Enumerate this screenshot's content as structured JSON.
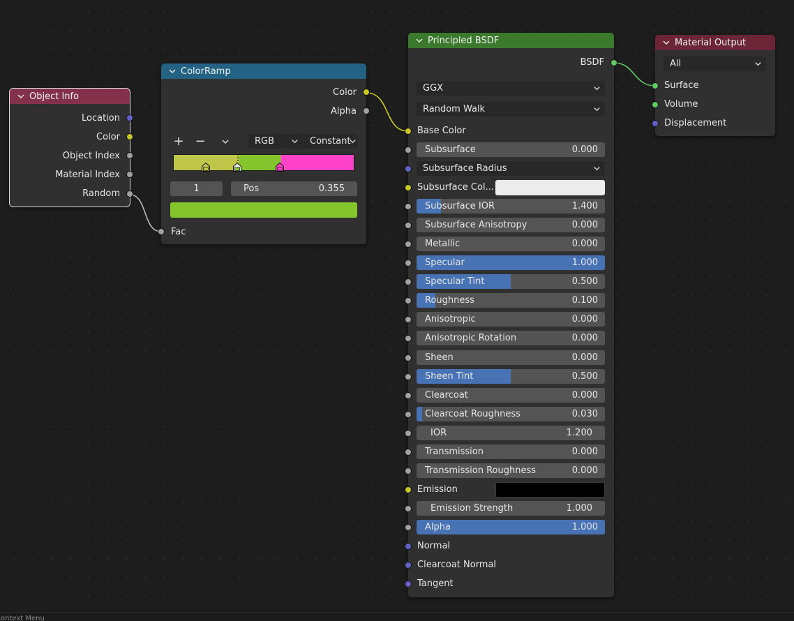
{
  "colors": {
    "object_info_header": "#83314a",
    "colorramp_header": "#246283",
    "principled_header": "#3b7a2c",
    "output_header": "#6b2537",
    "socket_gray": "#a1a1a1",
    "socket_yellow": "#c7c729",
    "socket_green": "#63c763",
    "socket_purple": "#6363c7",
    "slider_fill": "#4772b3",
    "ramp_colors": [
      "#c0c64a",
      "#84c52d",
      "#ff43c8"
    ],
    "active_color": "#84c52d",
    "subsurface_color": "#ececec",
    "emission_color": "#000000"
  },
  "object_info": {
    "title": "Object Info",
    "outputs": [
      "Location",
      "Color",
      "Object Index",
      "Material Index",
      "Random"
    ]
  },
  "colorramp": {
    "title": "ColorRamp",
    "outputs": [
      "Color",
      "Alpha"
    ],
    "tools": {
      "add": "+",
      "remove": "−"
    },
    "color_mode": "RGB",
    "interpolation": "Constant",
    "stop_positions": [
      0.18,
      0.355,
      0.59
    ],
    "active_index": "1",
    "pos_label": "Pos",
    "pos_value": "0.355",
    "input": "Fac"
  },
  "principled": {
    "title": "Principled BSDF",
    "output": "BSDF",
    "distribution": "GGX",
    "subsurface_method": "Random Walk",
    "base_color_label": "Base Color",
    "subsurface_radius_label": "Subsurface Radius",
    "subsurface_color_label": "Subsurface Col...",
    "emission_label": "Emission",
    "fields": {
      "subsurface": {
        "label": "Subsurface",
        "value": "0.000",
        "fill": 0
      },
      "subsurface_ior": {
        "label": "Subsurface IOR",
        "value": "1.400",
        "fill": 0.13
      },
      "subsurface_anisotropy": {
        "label": "Subsurface Anisotropy",
        "value": "0.000",
        "fill": 0
      },
      "metallic": {
        "label": "Metallic",
        "value": "0.000",
        "fill": 0
      },
      "specular": {
        "label": "Specular",
        "value": "1.000",
        "fill": 1
      },
      "specular_tint": {
        "label": "Specular Tint",
        "value": "0.500",
        "fill": 0.5
      },
      "roughness": {
        "label": "Roughness",
        "value": "0.100",
        "fill": 0.1
      },
      "anisotropic": {
        "label": "Anisotropic",
        "value": "0.000",
        "fill": 0
      },
      "anisotropic_rotation": {
        "label": "Anisotropic Rotation",
        "value": "0.000",
        "fill": 0
      },
      "sheen": {
        "label": "Sheen",
        "value": "0.000",
        "fill": 0
      },
      "sheen_tint": {
        "label": "Sheen Tint",
        "value": "0.500",
        "fill": 0.5
      },
      "clearcoat": {
        "label": "Clearcoat",
        "value": "0.000",
        "fill": 0
      },
      "clearcoat_roughness": {
        "label": "Clearcoat Roughness",
        "value": "0.030",
        "fill": 0.03
      },
      "ior": {
        "label": "IOR",
        "value": "1.200",
        "fill": 0
      },
      "transmission": {
        "label": "Transmission",
        "value": "0.000",
        "fill": 0
      },
      "transmission_roughness": {
        "label": "Transmission Roughness",
        "value": "0.000",
        "fill": 0
      },
      "emission_strength": {
        "label": "Emission Strength",
        "value": "1.000",
        "fill": 0
      },
      "alpha": {
        "label": "Alpha",
        "value": "1.000",
        "fill": 1
      }
    },
    "vector_inputs": [
      "Normal",
      "Clearcoat Normal",
      "Tangent"
    ]
  },
  "material_output": {
    "title": "Material Output",
    "target": "All",
    "inputs": [
      "Surface",
      "Volume",
      "Displacement"
    ]
  },
  "statusbar": {
    "text": "Context Menu"
  }
}
